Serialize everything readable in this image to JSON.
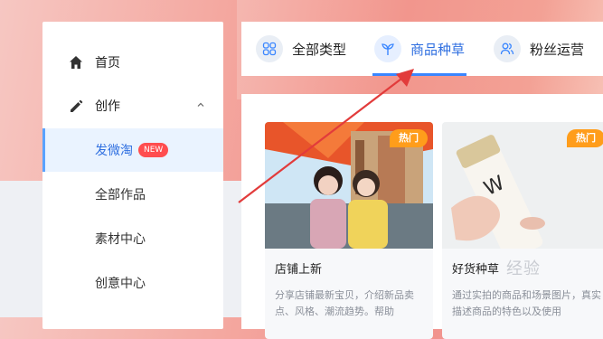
{
  "sidebar": {
    "items": [
      {
        "label": "首页",
        "icon": "home-icon"
      },
      {
        "label": "创作",
        "icon": "pen-icon"
      },
      {
        "label": "发微淘",
        "badge": "NEW",
        "active": true
      },
      {
        "label": "全部作品"
      },
      {
        "label": "素材中心"
      },
      {
        "label": "创意中心"
      }
    ]
  },
  "tabs": [
    {
      "label": "全部类型",
      "icon": "grid-icon"
    },
    {
      "label": "商品种草",
      "icon": "sprout-icon",
      "active": true
    },
    {
      "label": "粉丝运营",
      "icon": "users-icon"
    }
  ],
  "cards": [
    {
      "title": "店铺上新",
      "badge": "热门",
      "desc": "分享店铺最新宝贝，介绍新品卖点、风格、潮流趋势。帮助"
    },
    {
      "title": "好货种草",
      "badge": "热门",
      "desc": "通过实拍的商品和场景图片，真实描述商品的特色以及使用"
    }
  ],
  "watermark": "经验",
  "colors": {
    "accent": "#2f6fe0",
    "badge_new": "#ff4d4f",
    "badge_hot": "#ff9d1b",
    "annotation_arrow": "#e23b3b"
  }
}
